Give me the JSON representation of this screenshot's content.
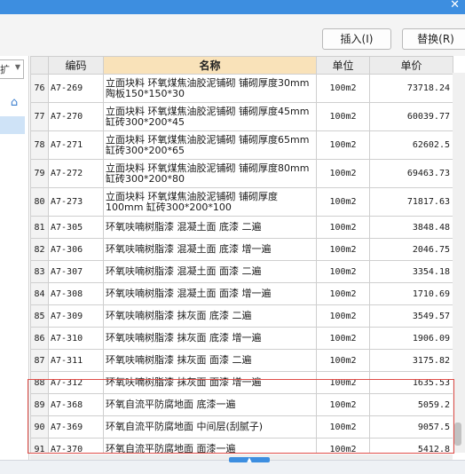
{
  "window": {
    "close_glyph": "✕"
  },
  "toolbar": {
    "insert_label": "插入(I)",
    "replace_label": "替换(R)"
  },
  "left_pane": {
    "select_value": "扩",
    "icon": "building-icon"
  },
  "table": {
    "headers": [
      "",
      "编码",
      "名称",
      "单位",
      "单价"
    ],
    "rows": [
      {
        "idx": "76",
        "code": "A7-269",
        "name": "立面块料 环氧煤焦油胶泥铺砌 铺砌厚度30mm 陶板150*150*30",
        "unit": "100m2",
        "price": "73718.24"
      },
      {
        "idx": "77",
        "code": "A7-270",
        "name": "立面块料 环氧煤焦油胶泥铺砌 铺砌厚度45mm 缸砖300*200*45",
        "unit": "100m2",
        "price": "60039.77"
      },
      {
        "idx": "78",
        "code": "A7-271",
        "name": "立面块料 环氧煤焦油胶泥铺砌 铺砌厚度65mm 缸砖300*200*65",
        "unit": "100m2",
        "price": "62602.5"
      },
      {
        "idx": "79",
        "code": "A7-272",
        "name": "立面块料 环氧煤焦油胶泥铺砌 铺砌厚度80mm 缸砖300*200*80",
        "unit": "100m2",
        "price": "69463.73"
      },
      {
        "idx": "80",
        "code": "A7-273",
        "name": "立面块料 环氧煤焦油胶泥铺砌 铺砌厚度100mm 缸砖300*200*100",
        "unit": "100m2",
        "price": "71817.63"
      },
      {
        "idx": "81",
        "code": "A7-305",
        "name": "环氧呋喃树脂漆 混凝土面 底漆 二遍",
        "unit": "100m2",
        "price": "3848.48"
      },
      {
        "idx": "82",
        "code": "A7-306",
        "name": "环氧呋喃树脂漆 混凝土面 底漆 增一遍",
        "unit": "100m2",
        "price": "2046.75"
      },
      {
        "idx": "83",
        "code": "A7-307",
        "name": "环氧呋喃树脂漆 混凝土面 面漆 二遍",
        "unit": "100m2",
        "price": "3354.18"
      },
      {
        "idx": "84",
        "code": "A7-308",
        "name": "环氧呋喃树脂漆 混凝土面 面漆 增一遍",
        "unit": "100m2",
        "price": "1710.69"
      },
      {
        "idx": "85",
        "code": "A7-309",
        "name": "环氧呋喃树脂漆 抹灰面 底漆 二遍",
        "unit": "100m2",
        "price": "3549.57"
      },
      {
        "idx": "86",
        "code": "A7-310",
        "name": "环氧呋喃树脂漆 抹灰面 底漆 增一遍",
        "unit": "100m2",
        "price": "1906.09"
      },
      {
        "idx": "87",
        "code": "A7-311",
        "name": "环氧呋喃树脂漆 抹灰面 面漆 二遍",
        "unit": "100m2",
        "price": "3175.82"
      },
      {
        "idx": "88",
        "code": "A7-312",
        "name": "环氧呋喃树脂漆 抹灰面 面漆 增一遍",
        "unit": "100m2",
        "price": "1635.53"
      },
      {
        "idx": "89",
        "code": "A7-368",
        "name": "环氧自流平防腐地面 底漆一遍",
        "unit": "100m2",
        "price": "5059.2"
      },
      {
        "idx": "90",
        "code": "A7-369",
        "name": "环氧自流平防腐地面 中间层(刮腻子)",
        "unit": "100m2",
        "price": "9057.5"
      },
      {
        "idx": "91",
        "code": "A7-370",
        "name": "环氧自流平防腐地面 面漆一遍",
        "unit": "100m2",
        "price": "5412.8"
      }
    ]
  },
  "colors": {
    "titlebar": "#3d8ee0",
    "header_highlight": "#f9e2b9",
    "selection_box": "#e04d48"
  }
}
